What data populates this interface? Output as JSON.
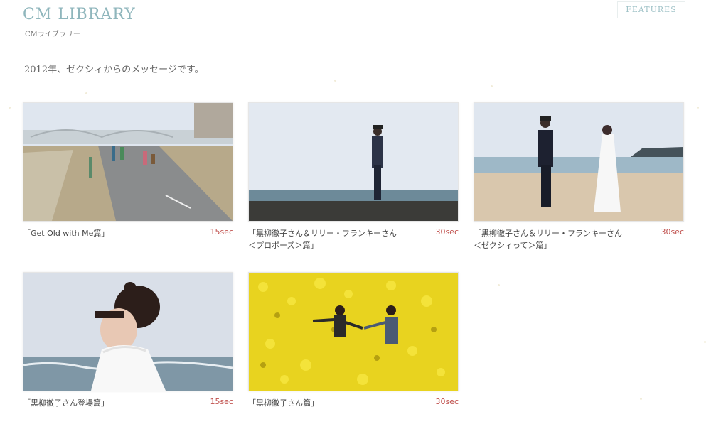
{
  "header": {
    "title": "CM LIBRARY",
    "subtitle": "CMライブラリー",
    "features_label": "FEATURES"
  },
  "lead": "2012年、ゼクシィからのメッセージです。",
  "videos": [
    {
      "title_line1": "「Get Old with Me篇」",
      "title_line2": "",
      "duration": "15sec"
    },
    {
      "title_line1": "「黒柳徹子さん＆リリー・フランキーさん",
      "title_line2": "＜プロポーズ＞篇」",
      "duration": "30sec"
    },
    {
      "title_line1": "「黒柳徹子さん＆リリー・フランキーさん",
      "title_line2": "＜ゼクシィって＞篇」",
      "duration": "30sec"
    },
    {
      "title_line1": "「黒柳徹子さん登場篇」",
      "title_line2": "",
      "duration": "15sec"
    },
    {
      "title_line1": "「黒柳徹子さん篇」",
      "title_line2": "",
      "duration": "30sec"
    }
  ]
}
